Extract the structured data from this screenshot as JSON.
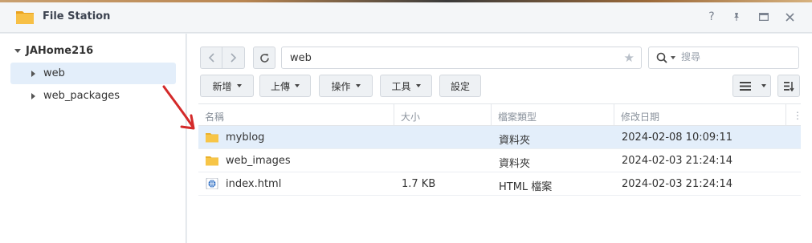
{
  "window": {
    "title": "File Station",
    "controls": {
      "help": "?",
      "pin": "📌",
      "maximize": "▭",
      "close": "✕"
    }
  },
  "sidebar": {
    "root": "JAHome216",
    "items": [
      {
        "label": "web",
        "selected": true
      },
      {
        "label": "web_packages",
        "selected": false
      }
    ]
  },
  "toolbar": {
    "path": "web",
    "search_placeholder": "搜尋",
    "buttons": {
      "create": "新增",
      "upload": "上傳",
      "action": "操作",
      "tools": "工具",
      "settings": "設定"
    }
  },
  "table": {
    "columns": [
      "名稱",
      "大小",
      "檔案類型",
      "修改日期"
    ],
    "rows": [
      {
        "name": "myblog",
        "size": "",
        "type": "資料夾",
        "modified": "2024-02-08 10:09:11",
        "icon": "folder-icon",
        "selected": true
      },
      {
        "name": "web_images",
        "size": "",
        "type": "資料夾",
        "modified": "2024-02-03 21:24:14",
        "icon": "folder-icon",
        "selected": false
      },
      {
        "name": "index.html",
        "size": "1.7 KB",
        "type": "HTML 檔案",
        "modified": "2024-02-03 21:24:14",
        "icon": "html-file-icon",
        "selected": false
      }
    ]
  },
  "colors": {
    "accent": "#3b7dd8",
    "folder": "#f5b82e",
    "selected_row": "#e3eefa",
    "annotation_arrow": "#d42a2a"
  }
}
